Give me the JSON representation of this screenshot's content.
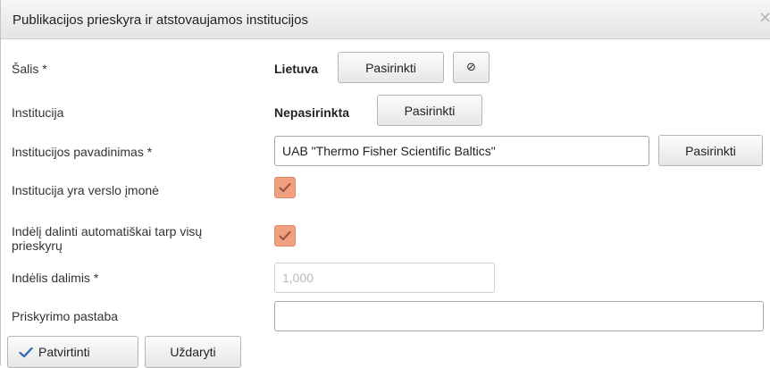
{
  "dialog": {
    "title": "Publikacijos prieskyra ir atstovaujamos institucijos",
    "close_glyph": "✕"
  },
  "fields": {
    "country": {
      "label": "Šalis *",
      "value": "Lietuva",
      "select_label": "Pasirinkti",
      "clear_glyph": "⊘"
    },
    "institution": {
      "label": "Institucija",
      "value": "Nepasirinkta",
      "select_label": "Pasirinkti"
    },
    "institution_name": {
      "label": "Institucijos pavadinimas *",
      "value": "UAB \"Thermo Fisher Scientific Baltics\"",
      "select_label": "Pasirinkti"
    },
    "is_business": {
      "label": "Institucija yra verslo įmonė",
      "checked": true
    },
    "share_auto": {
      "label_line1": "Indėlį dalinti automatiškai tarp visų",
      "label_line2": "prieskyrų",
      "checked": true
    },
    "contribution": {
      "label": "Indėlis dalimis *",
      "value": "1,000"
    },
    "note": {
      "label": "Priskyrimo pastaba",
      "value": ""
    }
  },
  "footer": {
    "confirm_label": "Patvirtinti",
    "close_label": "Uždaryti"
  },
  "colors": {
    "checkbox_fill": "#f0a07f",
    "confirm_icon": "#3a6fb0"
  }
}
